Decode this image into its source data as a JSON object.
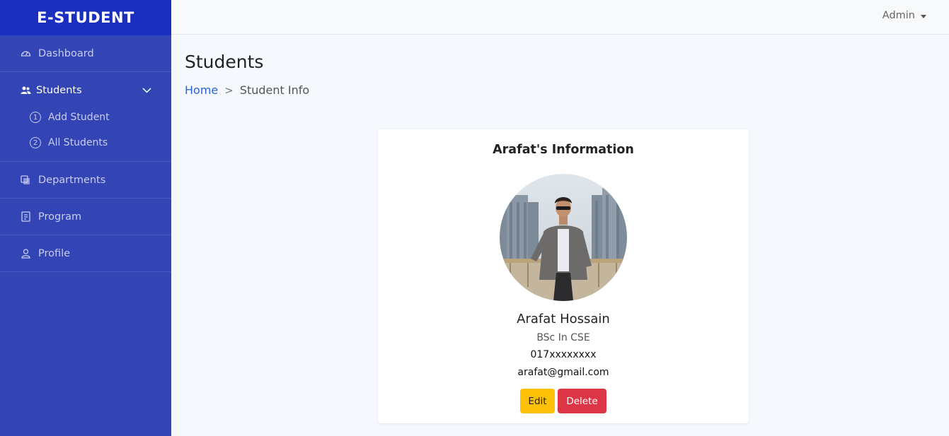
{
  "brand": "E-STUDENT",
  "sidebar": {
    "items": [
      {
        "label": "Dashboard",
        "icon": "dashboard-gauge-icon"
      },
      {
        "label": "Students",
        "icon": "users-icon",
        "active": true,
        "children": [
          {
            "num": "1",
            "label": "Add Student"
          },
          {
            "num": "2",
            "label": "All Students"
          }
        ]
      },
      {
        "label": "Departments",
        "icon": "departments-icon"
      },
      {
        "label": "Program",
        "icon": "program-icon"
      },
      {
        "label": "Profile",
        "icon": "person-icon"
      }
    ]
  },
  "topbar": {
    "user": "Admin"
  },
  "page": {
    "title": "Students",
    "breadcrumb": {
      "home": "Home",
      "separator": ">",
      "current": "Student Info"
    }
  },
  "card": {
    "title": "Arafat's Information",
    "name": "Arafat Hossain",
    "program": "BSc In CSE",
    "phone": "017xxxxxxxx",
    "email": "arafat@gmail.com",
    "edit_label": "Edit",
    "delete_label": "Delete"
  },
  "colors": {
    "sidebar": "#3344b5",
    "brand_bar": "#1a2ec0",
    "link": "#2d63d4",
    "edit": "#ffc107",
    "delete": "#dc3545"
  }
}
